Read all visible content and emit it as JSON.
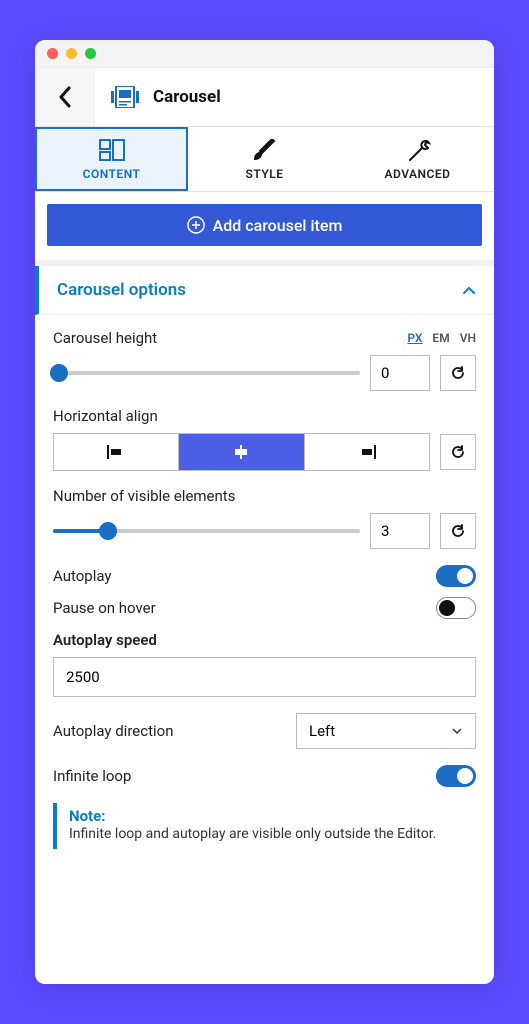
{
  "header": {
    "title": "Carousel"
  },
  "tabs": {
    "content": "CONTENT",
    "style": "STYLE",
    "advanced": "ADVANCED"
  },
  "add_button": "Add carousel item",
  "section": {
    "title": "Carousel options"
  },
  "fields": {
    "height": {
      "label": "Carousel height",
      "units": {
        "px": "PX",
        "em": "EM",
        "vh": "VH"
      },
      "value": "0",
      "slider_pct": 2
    },
    "halign": {
      "label": "Horizontal align"
    },
    "visible": {
      "label": "Number of visible elements",
      "value": "3",
      "slider_pct": 18
    },
    "autoplay": {
      "label": "Autoplay",
      "on": true
    },
    "pause_hover": {
      "label": "Pause on hover",
      "on": false
    },
    "autoplay_speed": {
      "label": "Autoplay speed",
      "value": "2500"
    },
    "autoplay_direction": {
      "label": "Autoplay direction",
      "value": "Left"
    },
    "infinite": {
      "label": "Infinite loop",
      "on": true
    },
    "note": {
      "title": "Note:",
      "text": "Infinite loop and autoplay are visible only outside the Editor."
    }
  }
}
